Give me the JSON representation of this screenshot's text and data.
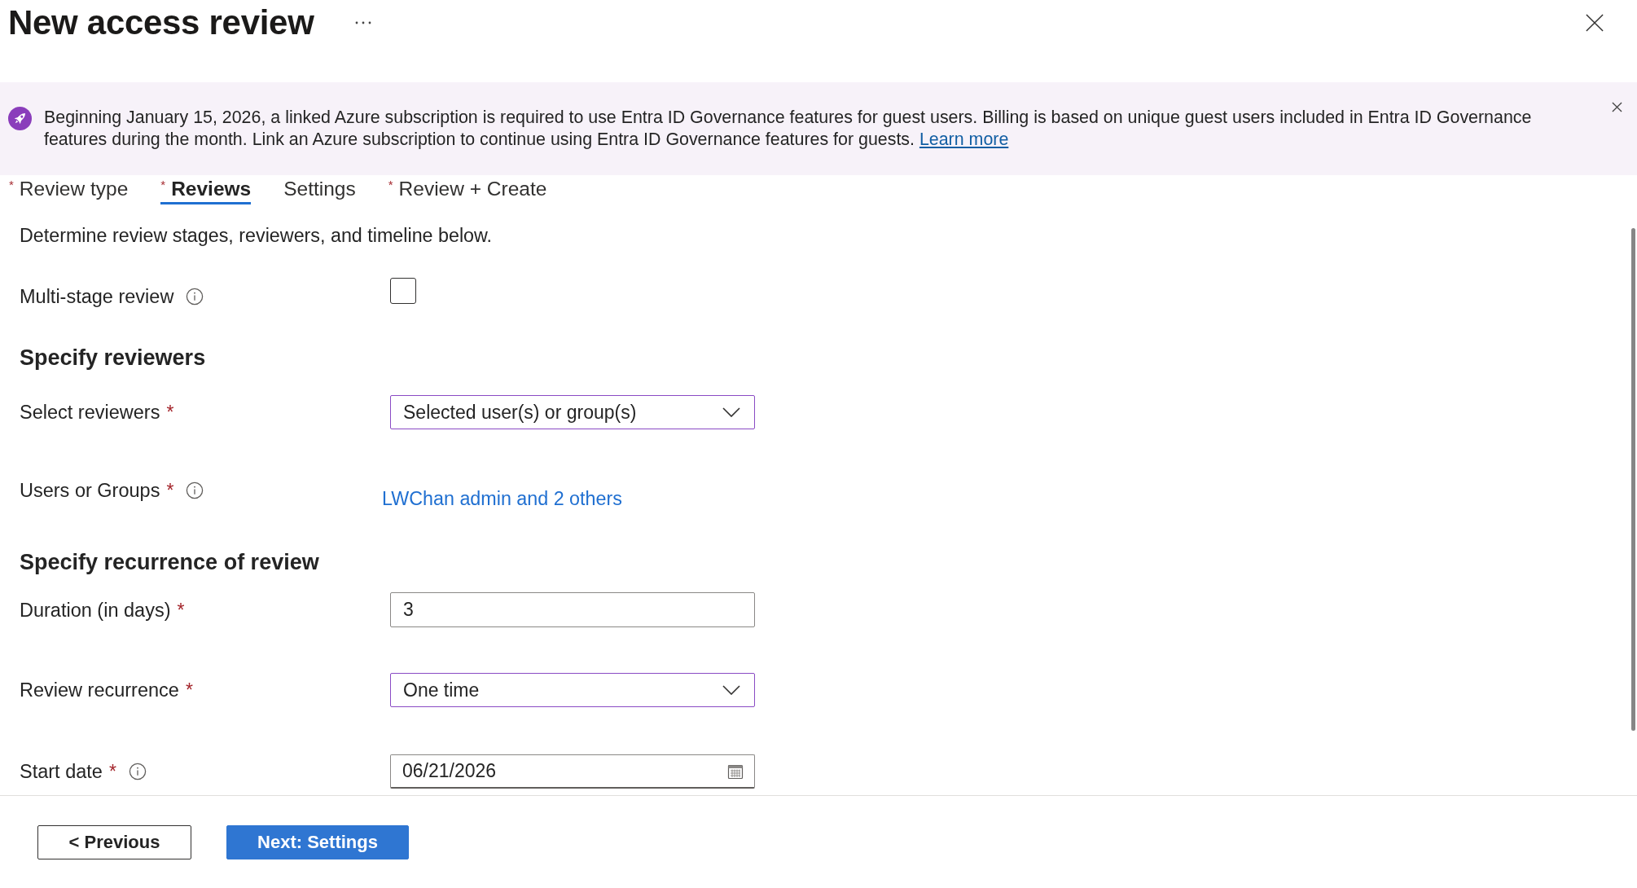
{
  "header": {
    "title": "New access review"
  },
  "banner": {
    "text": "Beginning January 15, 2026, a linked Azure subscription is required to use Entra ID Governance features for guest users. Billing is based on unique guest users included in Entra ID Governance features during the month. Link an Azure subscription to continue using Entra ID Governance features for guests.",
    "link": "Learn more"
  },
  "tabs": [
    {
      "label": "Review type",
      "asterisk": "*",
      "selected": false
    },
    {
      "label": "Reviews",
      "asterisk": "*",
      "selected": true
    },
    {
      "label": "Settings",
      "selected": false
    },
    {
      "label": "Review + Create",
      "asterisk": "*",
      "selected": false
    }
  ],
  "intro": "Determine review stages, reviewers, and timeline below.",
  "form": [
    {
      "kind": "checkbox",
      "label": "Multi-stage review",
      "info": true,
      "checked": false
    },
    {
      "kind": "heading",
      "label": "Specify reviewers"
    },
    {
      "kind": "dropdown",
      "label": "Select reviewers",
      "asterisk": "*",
      "info": false,
      "value": "Selected user(s) or group(s)"
    },
    {
      "kind": "link",
      "label": "Users or Groups",
      "asterisk": "*",
      "info": true,
      "value": "LWChan admin and 2 others"
    },
    {
      "kind": "heading",
      "label": "Specify recurrence of review"
    },
    {
      "kind": "text",
      "label": "Duration (in days)",
      "asterisk": "*",
      "info": false,
      "value": "3"
    },
    {
      "kind": "dropdown",
      "label": "Review recurrence",
      "asterisk": "*",
      "info": false,
      "value": "One time"
    },
    {
      "kind": "date",
      "label": "Start date",
      "asterisk": "*",
      "info": true,
      "value": "06/21/2026"
    }
  ],
  "footer": {
    "buttons": [
      {
        "label": "< Previous",
        "kind": "secondary"
      },
      {
        "label": "Next: Settings",
        "kind": "primary"
      }
    ]
  }
}
